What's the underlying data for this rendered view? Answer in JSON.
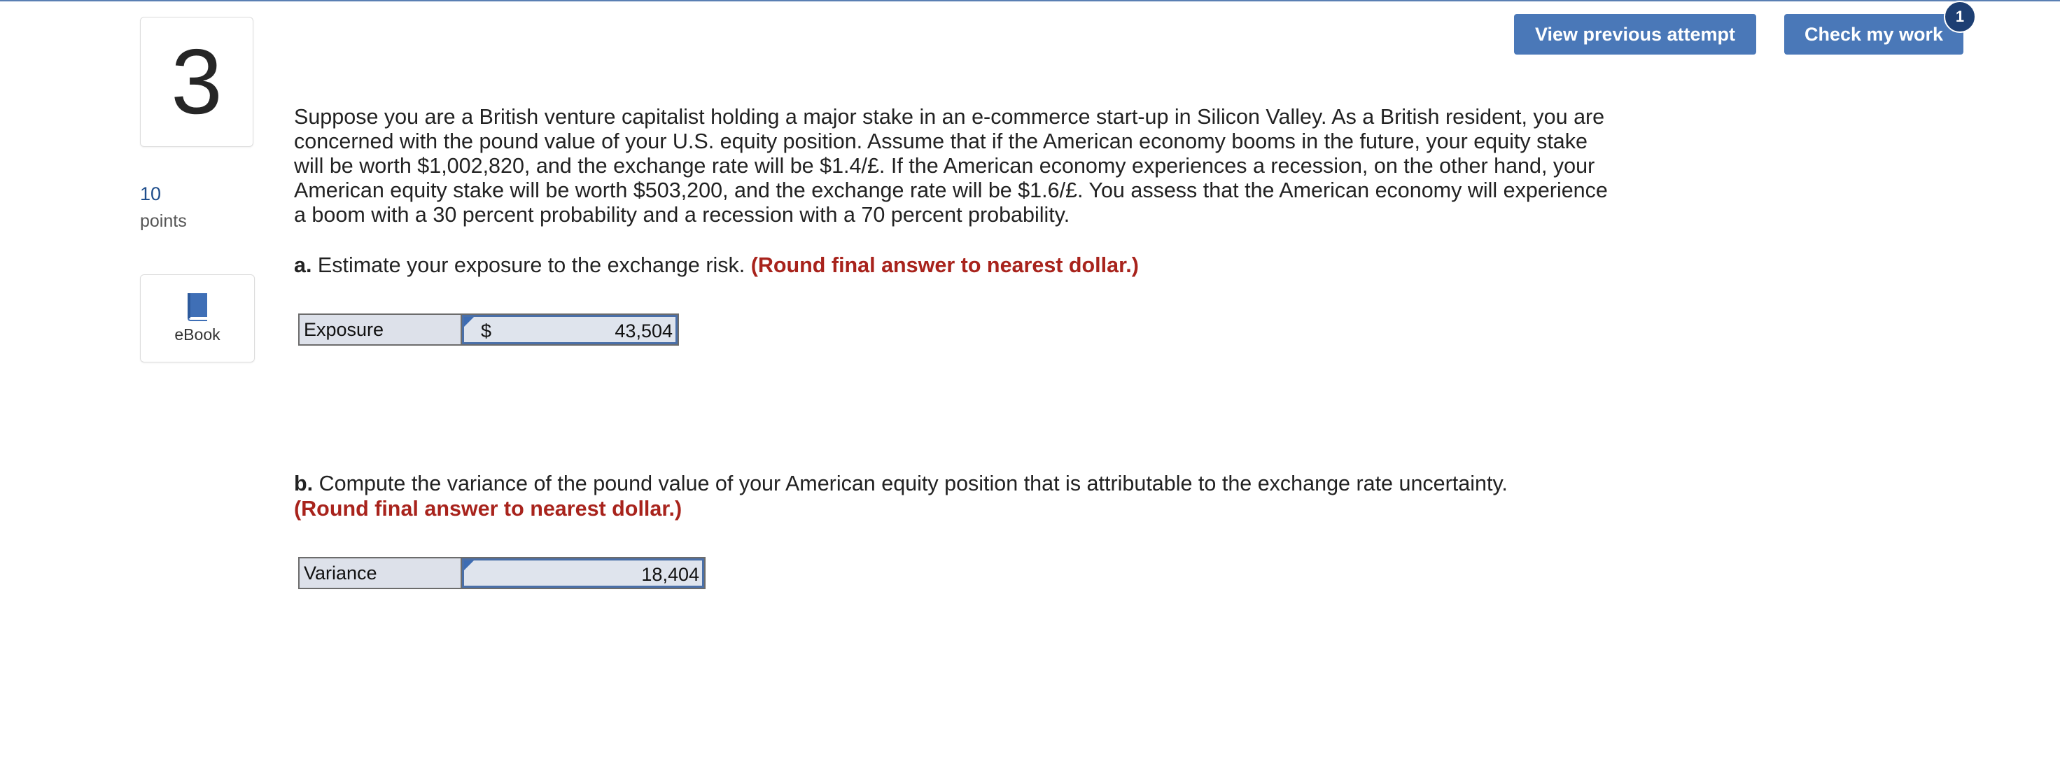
{
  "question": {
    "number": "3",
    "points_value": "10",
    "points_label": "points",
    "ebook_label": "eBook",
    "text": "Suppose you are a British venture capitalist holding a major stake in an e-commerce start-up in Silicon Valley. As a British resident, you are concerned with the pound value of your U.S. equity position. Assume that if the American economy booms in the future, your equity stake will be worth $1,002,820, and the exchange rate will be $1.4/£. If the American economy experiences a recession, on the other hand, your American equity stake will be worth $503,200, and the exchange rate will be $1.6/£. You assess that the American economy will experience a boom with a 30 percent probability and a recession with a 70 percent probability."
  },
  "toolbar": {
    "view_previous_label": "View previous attempt",
    "check_work_label": "Check my work",
    "check_work_badge": "1"
  },
  "part_a": {
    "letter": "a.",
    "prompt": "Estimate your exposure to the exchange risk.",
    "round_note": "(Round final answer to nearest dollar.)",
    "row_label": "Exposure",
    "currency": "$",
    "value": "43,504"
  },
  "part_b": {
    "letter": "b.",
    "prompt": "Compute the variance of the pound value of your American equity position that is attributable to the exchange rate uncertainty.",
    "round_note": "(Round final answer to nearest dollar.)",
    "row_label": "Variance",
    "value": "18,404"
  },
  "colors": {
    "button": "#4a78b8",
    "badge": "#1d3f73",
    "round_note": "#a8231c",
    "points_value": "#1f4e8c",
    "ebook_icon": "#3f6fb6"
  },
  "icons": {
    "ebook": "book-icon",
    "answer_flag": "flag-icon"
  }
}
